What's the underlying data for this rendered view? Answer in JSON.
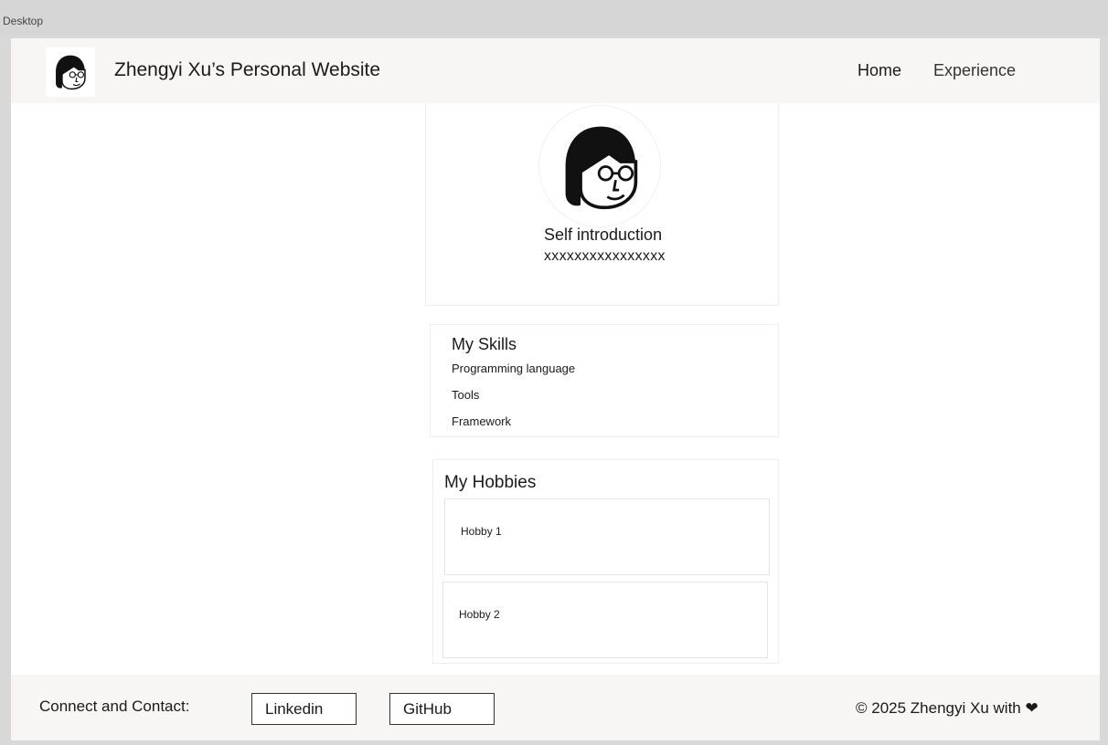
{
  "frame": {
    "label": "Desktop"
  },
  "header": {
    "title": "Zhengyi Xu’s Personal Website",
    "nav": [
      {
        "label": "Home"
      },
      {
        "label": "Experience"
      }
    ]
  },
  "intro": {
    "title": "Self introduction",
    "text": "xxxxxxxxxxxxxxxx"
  },
  "skills": {
    "title": "My Skills",
    "items": [
      "Programming language",
      "Tools",
      "Framework"
    ]
  },
  "hobbies": {
    "title": "My Hobbies",
    "items": [
      "Hobby 1",
      "Hobby 2"
    ]
  },
  "footer": {
    "contact_label": "Connect and Contact:",
    "buttons": [
      {
        "label": "Linkedin"
      },
      {
        "label": "GitHub"
      }
    ],
    "copyright": "© 2025 Zhengyi Xu with",
    "heart": "❤"
  },
  "icons": {
    "logo": "avatar-icon",
    "profile": "avatar-icon",
    "heart": "heart-icon"
  }
}
